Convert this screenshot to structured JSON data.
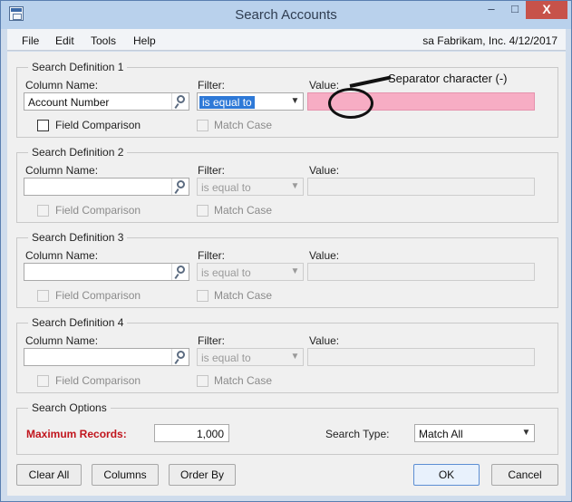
{
  "window": {
    "title": "Search Accounts",
    "minimize_label": "–",
    "maximize_label": "□",
    "close_label": "X"
  },
  "menu": {
    "items": [
      "File",
      "Edit",
      "Tools",
      "Help"
    ],
    "user_info": "sa  Fabrikam, Inc.  4/12/2017"
  },
  "labels": {
    "column_name": "Column Name:",
    "filter": "Filter:",
    "value": "Value:",
    "field_comparison": "Field Comparison",
    "match_case": "Match Case"
  },
  "search_definitions": [
    {
      "title": "Search Definition 1",
      "column_value": "Account Number",
      "filter_value": "is equal to",
      "value": "",
      "enabled": true
    },
    {
      "title": "Search Definition 2",
      "column_value": "",
      "filter_value": "is equal to",
      "value": "",
      "enabled": false
    },
    {
      "title": "Search Definition 3",
      "column_value": "",
      "filter_value": "is equal to",
      "value": "",
      "enabled": false
    },
    {
      "title": "Search Definition 4",
      "column_value": "",
      "filter_value": "is equal to",
      "value": "",
      "enabled": false
    }
  ],
  "search_options": {
    "title": "Search Options",
    "maximum_records_label": "Maximum Records:",
    "maximum_records_value": "1,000",
    "search_type_label": "Search Type:",
    "search_type_value": "Match All"
  },
  "buttons": {
    "clear_all": "Clear All",
    "columns": "Columns",
    "order_by": "Order By",
    "ok": "OK",
    "cancel": "Cancel"
  },
  "annotation": {
    "text": "Separator character (-)"
  },
  "colors": {
    "value_highlight": "#f7adc4",
    "maximum_records_label": "#c1151d"
  },
  "icons": {
    "lookup": "magnifier-icon"
  }
}
